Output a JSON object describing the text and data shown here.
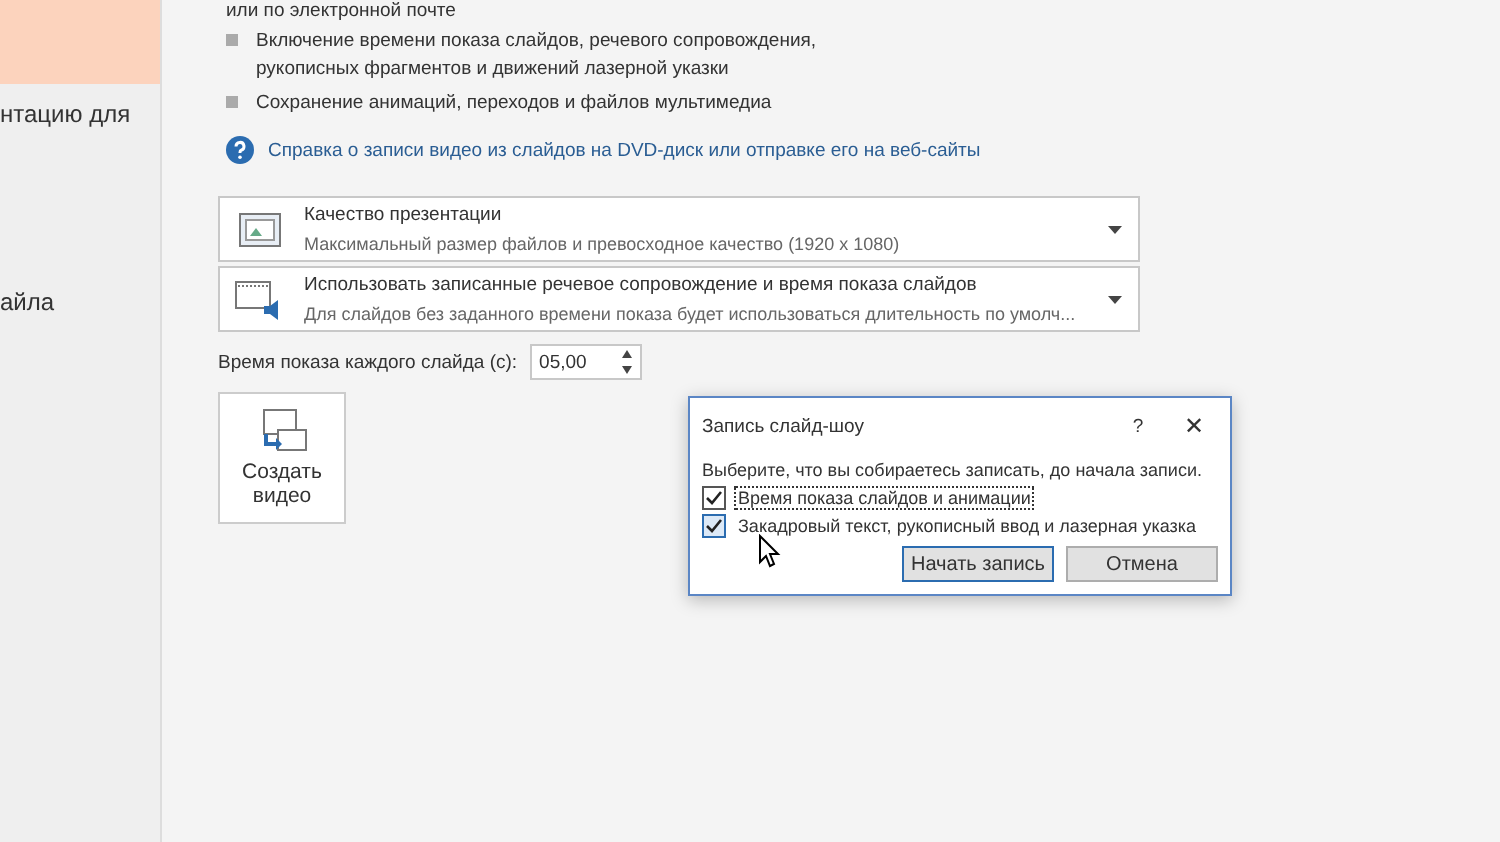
{
  "sidebar": {
    "items": [
      {
        "selected": true
      },
      {
        "label": "нтацию для",
        "selected": false
      },
      {
        "label": "айла",
        "selected": false
      }
    ]
  },
  "export": {
    "intro": "или по электронной почте",
    "bullets": [
      "Включение времени показа слайдов, речевого сопровождения, рукописных фрагментов и движений лазерной указки",
      "Сохранение анимаций, переходов и файлов мультимедиа"
    ],
    "help_link": "Справка о записи видео из слайдов на DVD-диск или отправке его на веб-сайты",
    "dropdowns": [
      {
        "kind": "quality",
        "title": "Качество презентации",
        "subtitle": "Максимальный размер файлов и превосходное качество (1920 x 1080)"
      },
      {
        "kind": "narration",
        "title": "Использовать записанные речевое сопровождение и время показа слайдов",
        "subtitle": "Для слайдов без заданного времени показа будет использоваться длительность по умолч..."
      }
    ],
    "seconds_label": "Время показа каждого слайда (с):",
    "seconds_value": "05,00",
    "create_button": "Создать видео"
  },
  "dialog": {
    "title": "Запись слайд-шоу",
    "help": "?",
    "close": "✕",
    "prompt": "Выберите, что вы собираетесь записать, до начала записи.",
    "options": [
      {
        "label": "Время показа слайдов и анимации",
        "checked": true
      },
      {
        "label": "Закадровый текст, рукописный ввод и лазерная указка",
        "checked": true
      }
    ],
    "buttons": [
      "Начать запись",
      "Отмена"
    ]
  }
}
